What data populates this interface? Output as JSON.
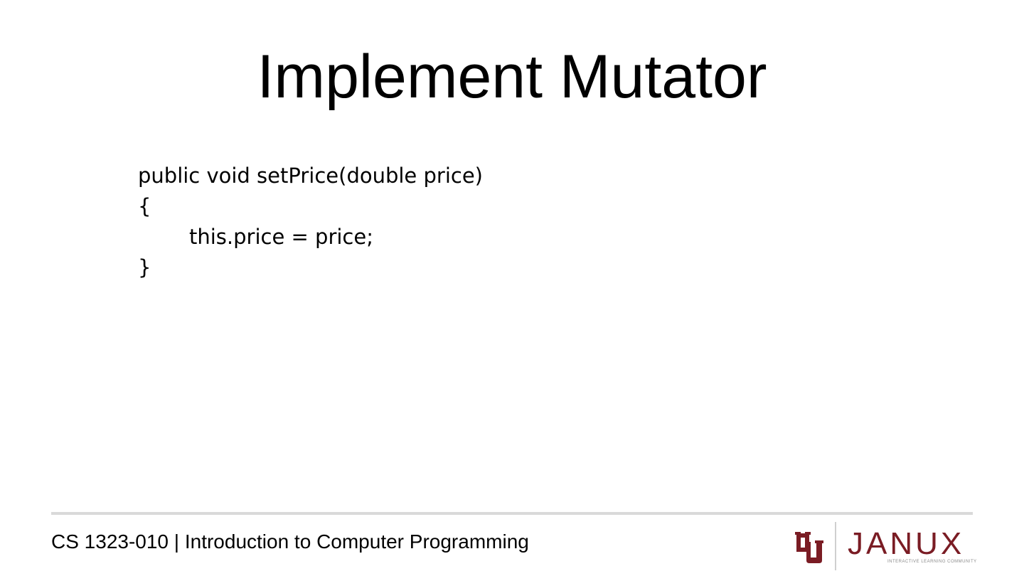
{
  "slide": {
    "title": "Implement Mutator",
    "code_lines": [
      "public void setPrice(double price)",
      "{",
      "this.price = price;",
      "}"
    ]
  },
  "footer": {
    "course": "CS 1323-010 | Introduction to Computer Programming",
    "logo": {
      "brand_mark": "ou-logo-icon",
      "wordmark": "JANUX",
      "tagline": "INTERACTIVE LEARNING COMMUNITY",
      "brand_color": "#7a1c24"
    }
  }
}
